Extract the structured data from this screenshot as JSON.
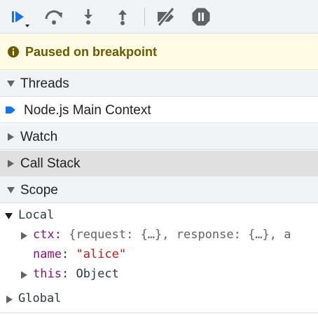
{
  "toolbar": {
    "buttons": [
      {
        "name": "resume-icon",
        "color": "#1a73e8"
      },
      {
        "name": "step-over-icon",
        "color": "#5f6368"
      },
      {
        "name": "step-into-icon",
        "color": "#5f6368"
      },
      {
        "name": "step-out-icon",
        "color": "#5f6368"
      },
      {
        "name": "deactivate-breakpoints-icon",
        "color": "#5f6368"
      },
      {
        "name": "pause-on-exceptions-icon",
        "color": "#5f6368"
      }
    ]
  },
  "banner": {
    "text": "Paused on breakpoint",
    "icon": "info-icon",
    "background": "#fffbe5",
    "text_color": "#6a5a00"
  },
  "sections": {
    "threads": {
      "label": "Threads",
      "expanded": true
    },
    "watch": {
      "label": "Watch",
      "expanded": false
    },
    "call_stack": {
      "label": "Call Stack",
      "expanded": false
    },
    "scope": {
      "label": "Scope",
      "expanded": true
    }
  },
  "threads": {
    "items": [
      {
        "label": "Node.js Main Context",
        "icon": "current-thread-arrow-icon"
      }
    ]
  },
  "scope": {
    "local": {
      "label": "Local",
      "properties": {
        "ctx": {
          "name": "ctx",
          "sep": ":",
          "preview": "{request: {…}, response: {…}, a"
        },
        "name": {
          "name": "name",
          "sep": ":",
          "value": "\"alice\""
        },
        "this": {
          "name": "this",
          "sep": ":",
          "value": "Object"
        }
      }
    },
    "global": {
      "label": "Global"
    }
  }
}
